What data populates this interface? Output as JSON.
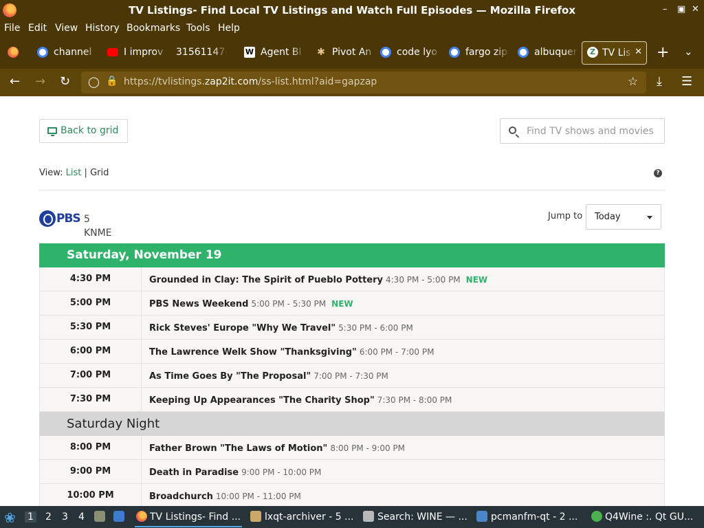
{
  "window": {
    "title": "TV Listings- Find Local TV Listings and Watch Full Episodes — Mozilla Firefox"
  },
  "menu": [
    "File",
    "Edit",
    "View",
    "History",
    "Bookmarks",
    "Tools",
    "Help"
  ],
  "tabs": [
    {
      "label": "channel",
      "icon": "google-icon"
    },
    {
      "label": "I improv",
      "icon": "youtube-icon"
    },
    {
      "label": "31561147-",
      "icon": "blank-icon"
    },
    {
      "label": "Agent Bl",
      "icon": "wikipedia-icon"
    },
    {
      "label": "Pivot An",
      "icon": "figure-icon"
    },
    {
      "label": "code lyo",
      "icon": "google-icon"
    },
    {
      "label": "fargo zip",
      "icon": "google-icon"
    },
    {
      "label": "albuquer",
      "icon": "google-icon"
    },
    {
      "label": "TV List",
      "icon": "zap2it-icon",
      "active": true
    }
  ],
  "address": {
    "url_prefix": "https://tvlistings.",
    "url_domain": "zap2it.com",
    "url_path": "/ss-list.html?aid=gapzap"
  },
  "page": {
    "back_button": "Back to grid",
    "search_placeholder": "Find TV shows and movies",
    "view_label": "View:",
    "view_list": "List",
    "view_sep": "|",
    "view_grid": "Grid",
    "help": "?",
    "logo_text": "PBS",
    "channel_number": "5",
    "channel_call": "KNME",
    "jump_label": "Jump to",
    "jump_value": "Today"
  },
  "sections": [
    {
      "header": "Saturday, November 19",
      "style": "green",
      "rows": [
        {
          "time": "4:30 PM",
          "title": "Grounded in Clay: The Spirit of Pueblo Pottery",
          "range": "4:30 PM - 5:00 PM",
          "badge": "NEW"
        },
        {
          "time": "5:00 PM",
          "title": "PBS News Weekend",
          "range": "5:00 PM - 5:30 PM",
          "badge": "NEW"
        },
        {
          "time": "5:30 PM",
          "title": "Rick Steves' Europe \"Why We Travel\"",
          "range": "5:30 PM - 6:00 PM",
          "badge": ""
        },
        {
          "time": "6:00 PM",
          "title": "The Lawrence Welk Show \"Thanksgiving\"",
          "range": "6:00 PM - 7:00 PM",
          "badge": ""
        },
        {
          "time": "7:00 PM",
          "title": "As Time Goes By \"The Proposal\"",
          "range": "7:00 PM - 7:30 PM",
          "badge": ""
        },
        {
          "time": "7:30 PM",
          "title": "Keeping Up Appearances \"The Charity Shop\"",
          "range": "7:30 PM - 8:00 PM",
          "badge": ""
        }
      ]
    },
    {
      "header": "Saturday Night",
      "style": "grey",
      "rows": [
        {
          "time": "8:00 PM",
          "title": "Father Brown \"The Laws of Motion\"",
          "range": "8:00 PM - 9:00 PM",
          "badge": ""
        },
        {
          "time": "9:00 PM",
          "title": "Death in Paradise",
          "range": "9:00 PM - 10:00 PM",
          "badge": ""
        },
        {
          "time": "10:00 PM",
          "title": "Broadchurch",
          "range": "10:00 PM - 11:00 PM",
          "badge": ""
        }
      ]
    }
  ],
  "taskbar": {
    "workspaces": [
      "1",
      "2",
      "3",
      "4"
    ],
    "items": [
      "TV Listings- Find ...",
      "lxqt-archiver - 5 ...",
      "Search: WINE — ...",
      "pcmanfm-qt - 2 ...",
      "Q4Wine :. Qt GU..."
    ]
  },
  "colors": {
    "chrome": "#4a3606",
    "navbar": "#5d4409",
    "accent_green": "#2fb36b",
    "link_green": "#2e8a5a",
    "night_header": "#d6d6d6",
    "pbs_blue": "#1f3f9b"
  }
}
